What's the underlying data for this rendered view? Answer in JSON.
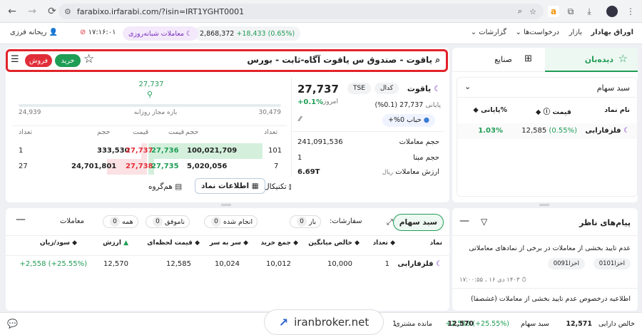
{
  "browser": {
    "url": "farabixo.irfarabi.com/?isin=IRT1YGHT0001"
  },
  "header": {
    "menu": [
      "اوراق بهادار",
      "بازار",
      "درخواست‌ها",
      "گزارشات"
    ],
    "index_value": "2,868,372",
    "index_change": "+18,433 (0.65%)",
    "overnight_label": "معاملات شبانه‌روزی",
    "clock": "۱۷:۱۶:۰۱",
    "user": "ریحانه فرزی"
  },
  "symbol_bar": {
    "title": "یاقوت - صندوق س یاقوت آگاه-ثابت - بورس",
    "buy": "خرید",
    "sell": "فروش"
  },
  "price_range": {
    "last": "27,737",
    "low": "24,939",
    "high": "30,479",
    "label": "بازه مجاز روزانه"
  },
  "order_book": {
    "headers": [
      "تعداد",
      "حجم",
      "قیمت",
      "قیمت",
      "حجم",
      "تعداد"
    ],
    "rows": [
      {
        "buy_count": "101",
        "buy_vol": "100,021,709",
        "buy_price": "27,736",
        "sell_price": "27,737",
        "sell_vol": "333,530",
        "sell_count": "1"
      },
      {
        "buy_count": "7",
        "buy_vol": "5,020,056",
        "buy_price": "27,735",
        "sell_price": "27,738",
        "sell_vol": "24,701,801",
        "sell_count": "27"
      }
    ],
    "buy_fill": [
      1.0,
      0.05
    ],
    "sell_fill": [
      0.01,
      0.07
    ]
  },
  "symbol_info": {
    "name": "یاقوت",
    "tag1": "کدال",
    "tag2": "TSE",
    "price": "27,737",
    "today": "امروز",
    "closing_label": "پایانی",
    "closing_value": "27,737 (0.1%)",
    "change": "+0.1%",
    "bubble_label": "حباب",
    "bubble_value": "0%+",
    "stats": [
      {
        "label": "حجم معاملات",
        "value": "241,091,536"
      },
      {
        "label": "حجم مبنا",
        "value": "1"
      },
      {
        "label": "ارزش معاملات",
        "unit": "ریال",
        "value": "6.69T"
      }
    ]
  },
  "info_tabs": [
    "تکنیکال",
    "اطلاعات نماد",
    "هم‌گروه"
  ],
  "watch": {
    "tab_watch": "دیده‌بان",
    "tab_industry": "صنایع",
    "basket": "سبد سهام",
    "headers": [
      "نام نماد",
      "قیمت",
      "%پایانی"
    ],
    "rows": [
      {
        "name": "فلزفارابی",
        "price": "12,585",
        "change": "(0.55%)",
        "closing": "1.03%"
      }
    ]
  },
  "portfolio": {
    "tab": "سبد سهام",
    "orders_label": "سفارشات:",
    "filters": [
      {
        "label": "باز",
        "count": "0"
      },
      {
        "label": "انجام شده",
        "count": "0"
      },
      {
        "label": "ناموفق",
        "count": "0"
      },
      {
        "label": "همه",
        "count": "0"
      }
    ],
    "trades": "معاملات",
    "headers": [
      "نماد",
      "تعداد",
      "خالص میانگین",
      "جمع خرید",
      "سر به سر",
      "قیمت لحظه‌ای",
      "ارزش",
      "سود/زیان"
    ],
    "rows": [
      {
        "symbol": "فلزفارابی",
        "count": "1",
        "avg": "10,000",
        "buy_sum": "10,012",
        "breakeven": "10,024",
        "price": "12,585",
        "value": "12,570",
        "pl": "+2,558 (+25.55%)"
      }
    ]
  },
  "messages": {
    "title": "پیام‌های ناظر",
    "items": [
      {
        "text": "عدم تایید بخشی از معاملات در برخی از نمادهای معاملاتی",
        "tags": [
          "اخزا0101",
          "اخزا0091"
        ],
        "time": "۱۴۰۳ دی ۱۶ ، ۱۷:۰۰:۵۵"
      },
      {
        "text": "اطلاعیه درخصوص عدم تایید بخشی از معاملات (غشصفا)"
      }
    ]
  },
  "footer": {
    "assets_label": "خالص دارایی",
    "assets_value": "12,571",
    "basket_label": "سبد سهام",
    "basket_pl": "+2,558 (+25.55%)",
    "basket_value": "12,570",
    "credit_label": "مانده مشتری",
    "credit_value": "1",
    "watermark": "iranbroker.net"
  },
  "colors": {
    "accent": "#1f9d55",
    "sell": "#e12d39",
    "highlight": "#e2232a"
  }
}
